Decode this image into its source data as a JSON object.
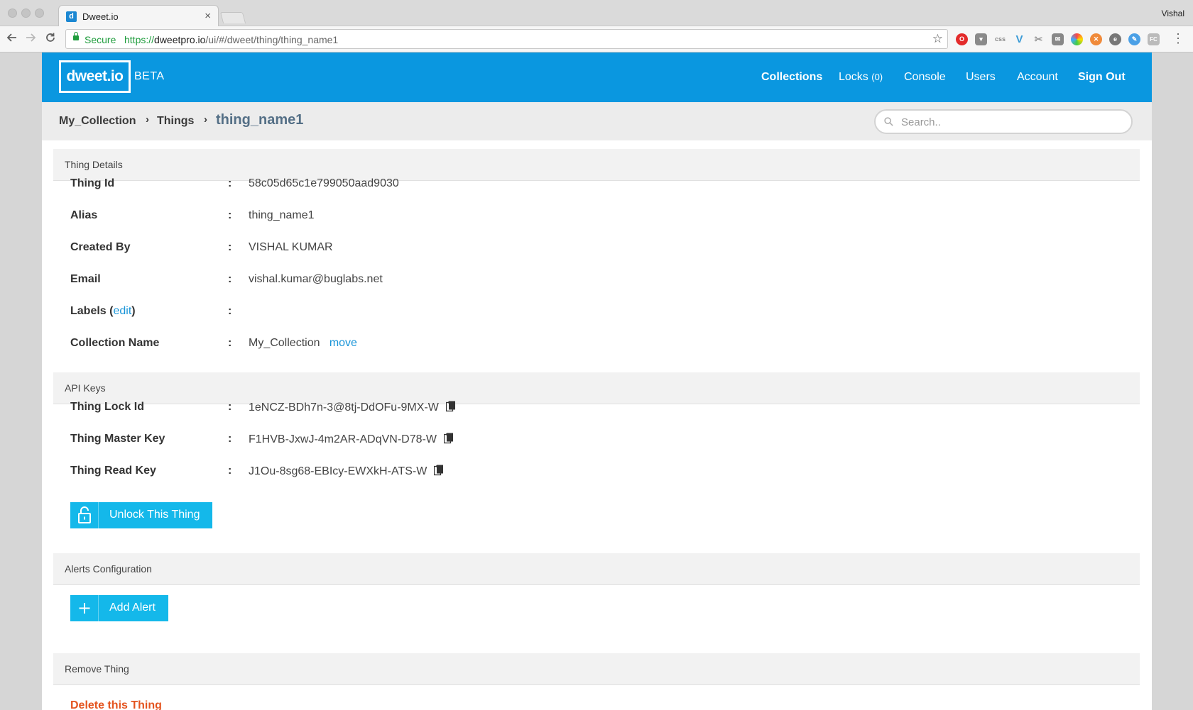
{
  "browser": {
    "tab_title": "Dweet.io",
    "tab_favicon": "d",
    "tab_close": "×",
    "profile_name": "Vishal",
    "secure_label": "Secure",
    "url_scheme": "https://",
    "url_host": "dweetpro.io",
    "url_path": "/ui/#/dweet/thing/thing_name1",
    "extension_icons": [
      "opera-icon",
      "pocket-icon",
      "css-icon",
      "vue-icon",
      "scissors-icon",
      "mail-icon",
      "color-wheel-icon",
      "close-circle-icon",
      "evernote-icon",
      "pencil-icon",
      "fc-icon"
    ],
    "ext_css_text": "css",
    "ext_fc_text": "FC"
  },
  "header": {
    "logo": "dweet.io",
    "badge": "BETA",
    "nav": {
      "collections": "Collections",
      "locks": "Locks",
      "locks_count": "(0)",
      "console": "Console",
      "users": "Users",
      "account": "Account",
      "sign_out": "Sign Out"
    }
  },
  "breadcrumb": {
    "items": [
      "My_Collection",
      "Things"
    ],
    "separator": "›",
    "current": "thing_name1"
  },
  "search": {
    "placeholder": "Search.."
  },
  "thing_details": {
    "title": "Thing Details",
    "rows": [
      {
        "label": "Thing Id",
        "value": "58c05d65c1e799050aad9030"
      },
      {
        "label": "Alias",
        "value": "thing_name1"
      },
      {
        "label": "Created By",
        "value": "VISHAL KUMAR"
      },
      {
        "label": "Email",
        "value": "vishal.kumar@buglabs.net"
      }
    ],
    "labels_prefix": "Labels (",
    "labels_edit": "edit",
    "labels_suffix": ")",
    "labels_value": "",
    "collection_label": "Collection Name",
    "collection_value": "My_Collection",
    "collection_move": "move",
    "colon": ":"
  },
  "api_keys": {
    "title": "API Keys",
    "rows": [
      {
        "label": "Thing Lock Id",
        "value": "1eNCZ-BDh7n-3@8tj-DdOFu-9MX-W"
      },
      {
        "label": "Thing Master Key",
        "value": "F1HVB-JxwJ-4m2AR-ADqVN-D78-W"
      },
      {
        "label": "Thing Read Key",
        "value": "J1Ou-8sg68-EBIcy-EWXkH-ATS-W"
      }
    ],
    "unlock_button": "Unlock This Thing"
  },
  "alerts": {
    "title": "Alerts Configuration",
    "add_button": "Add Alert"
  },
  "remove": {
    "title": "Remove Thing",
    "delete_link": "Delete this Thing"
  },
  "colors": {
    "header_bg": "#0a97e0",
    "button_bg": "#14b8ea",
    "link": "#1a95d8",
    "danger": "#e4541f",
    "secure_green": "#1f9d3d",
    "breadcrumb_current": "#546f86"
  }
}
